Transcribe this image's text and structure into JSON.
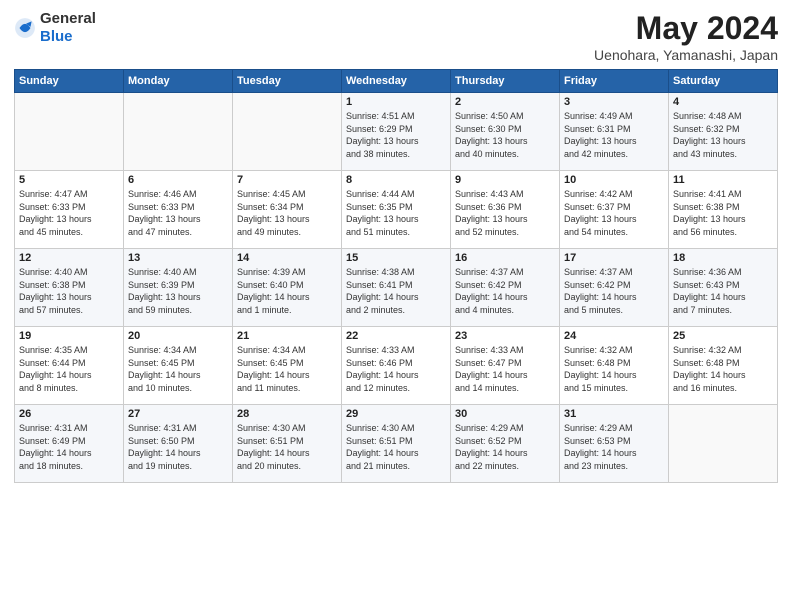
{
  "header": {
    "logo_general": "General",
    "logo_blue": "Blue",
    "month_title": "May 2024",
    "subtitle": "Uenohara, Yamanashi, Japan"
  },
  "weekdays": [
    "Sunday",
    "Monday",
    "Tuesday",
    "Wednesday",
    "Thursday",
    "Friday",
    "Saturday"
  ],
  "weeks": [
    [
      {
        "day": "",
        "info": ""
      },
      {
        "day": "",
        "info": ""
      },
      {
        "day": "",
        "info": ""
      },
      {
        "day": "1",
        "info": "Sunrise: 4:51 AM\nSunset: 6:29 PM\nDaylight: 13 hours\nand 38 minutes."
      },
      {
        "day": "2",
        "info": "Sunrise: 4:50 AM\nSunset: 6:30 PM\nDaylight: 13 hours\nand 40 minutes."
      },
      {
        "day": "3",
        "info": "Sunrise: 4:49 AM\nSunset: 6:31 PM\nDaylight: 13 hours\nand 42 minutes."
      },
      {
        "day": "4",
        "info": "Sunrise: 4:48 AM\nSunset: 6:32 PM\nDaylight: 13 hours\nand 43 minutes."
      }
    ],
    [
      {
        "day": "5",
        "info": "Sunrise: 4:47 AM\nSunset: 6:33 PM\nDaylight: 13 hours\nand 45 minutes."
      },
      {
        "day": "6",
        "info": "Sunrise: 4:46 AM\nSunset: 6:33 PM\nDaylight: 13 hours\nand 47 minutes."
      },
      {
        "day": "7",
        "info": "Sunrise: 4:45 AM\nSunset: 6:34 PM\nDaylight: 13 hours\nand 49 minutes."
      },
      {
        "day": "8",
        "info": "Sunrise: 4:44 AM\nSunset: 6:35 PM\nDaylight: 13 hours\nand 51 minutes."
      },
      {
        "day": "9",
        "info": "Sunrise: 4:43 AM\nSunset: 6:36 PM\nDaylight: 13 hours\nand 52 minutes."
      },
      {
        "day": "10",
        "info": "Sunrise: 4:42 AM\nSunset: 6:37 PM\nDaylight: 13 hours\nand 54 minutes."
      },
      {
        "day": "11",
        "info": "Sunrise: 4:41 AM\nSunset: 6:38 PM\nDaylight: 13 hours\nand 56 minutes."
      }
    ],
    [
      {
        "day": "12",
        "info": "Sunrise: 4:40 AM\nSunset: 6:38 PM\nDaylight: 13 hours\nand 57 minutes."
      },
      {
        "day": "13",
        "info": "Sunrise: 4:40 AM\nSunset: 6:39 PM\nDaylight: 13 hours\nand 59 minutes."
      },
      {
        "day": "14",
        "info": "Sunrise: 4:39 AM\nSunset: 6:40 PM\nDaylight: 14 hours\nand 1 minute."
      },
      {
        "day": "15",
        "info": "Sunrise: 4:38 AM\nSunset: 6:41 PM\nDaylight: 14 hours\nand 2 minutes."
      },
      {
        "day": "16",
        "info": "Sunrise: 4:37 AM\nSunset: 6:42 PM\nDaylight: 14 hours\nand 4 minutes."
      },
      {
        "day": "17",
        "info": "Sunrise: 4:37 AM\nSunset: 6:42 PM\nDaylight: 14 hours\nand 5 minutes."
      },
      {
        "day": "18",
        "info": "Sunrise: 4:36 AM\nSunset: 6:43 PM\nDaylight: 14 hours\nand 7 minutes."
      }
    ],
    [
      {
        "day": "19",
        "info": "Sunrise: 4:35 AM\nSunset: 6:44 PM\nDaylight: 14 hours\nand 8 minutes."
      },
      {
        "day": "20",
        "info": "Sunrise: 4:34 AM\nSunset: 6:45 PM\nDaylight: 14 hours\nand 10 minutes."
      },
      {
        "day": "21",
        "info": "Sunrise: 4:34 AM\nSunset: 6:45 PM\nDaylight: 14 hours\nand 11 minutes."
      },
      {
        "day": "22",
        "info": "Sunrise: 4:33 AM\nSunset: 6:46 PM\nDaylight: 14 hours\nand 12 minutes."
      },
      {
        "day": "23",
        "info": "Sunrise: 4:33 AM\nSunset: 6:47 PM\nDaylight: 14 hours\nand 14 minutes."
      },
      {
        "day": "24",
        "info": "Sunrise: 4:32 AM\nSunset: 6:48 PM\nDaylight: 14 hours\nand 15 minutes."
      },
      {
        "day": "25",
        "info": "Sunrise: 4:32 AM\nSunset: 6:48 PM\nDaylight: 14 hours\nand 16 minutes."
      }
    ],
    [
      {
        "day": "26",
        "info": "Sunrise: 4:31 AM\nSunset: 6:49 PM\nDaylight: 14 hours\nand 18 minutes."
      },
      {
        "day": "27",
        "info": "Sunrise: 4:31 AM\nSunset: 6:50 PM\nDaylight: 14 hours\nand 19 minutes."
      },
      {
        "day": "28",
        "info": "Sunrise: 4:30 AM\nSunset: 6:51 PM\nDaylight: 14 hours\nand 20 minutes."
      },
      {
        "day": "29",
        "info": "Sunrise: 4:30 AM\nSunset: 6:51 PM\nDaylight: 14 hours\nand 21 minutes."
      },
      {
        "day": "30",
        "info": "Sunrise: 4:29 AM\nSunset: 6:52 PM\nDaylight: 14 hours\nand 22 minutes."
      },
      {
        "day": "31",
        "info": "Sunrise: 4:29 AM\nSunset: 6:53 PM\nDaylight: 14 hours\nand 23 minutes."
      },
      {
        "day": "",
        "info": ""
      }
    ]
  ]
}
